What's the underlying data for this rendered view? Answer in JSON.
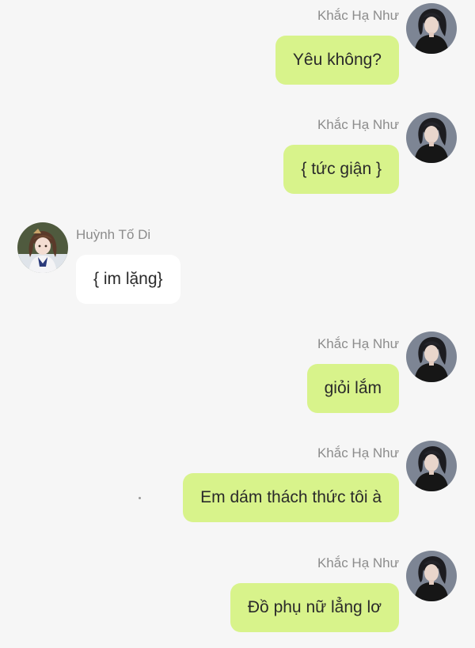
{
  "messages": [
    {
      "side": "right",
      "sender": "Khắc Hạ Như",
      "text": "Yêu không?",
      "avatar": "dark-hair-woman-avatar"
    },
    {
      "side": "right",
      "sender": "Khắc Hạ Như",
      "text": "{ tức giận }",
      "avatar": "dark-hair-woman-avatar"
    },
    {
      "side": "left",
      "sender": "Huỳnh Tố Di",
      "text": "{ im lặng}",
      "avatar": "schoolgirl-avatar"
    },
    {
      "side": "right",
      "sender": "Khắc Hạ Như",
      "text": "giỏi lắm",
      "avatar": "dark-hair-woman-avatar"
    },
    {
      "side": "right",
      "sender": "Khắc Hạ Như",
      "text": "Em dám thách thức tôi à",
      "avatar": "dark-hair-woman-avatar"
    },
    {
      "side": "right",
      "sender": "Khắc Hạ Như",
      "text": "Đồ phụ nữ lẳng lơ",
      "avatar": "dark-hair-woman-avatar"
    }
  ],
  "colors": {
    "background": "#f6f6f6",
    "outgoing_bubble": "#d8f38b",
    "incoming_bubble": "#ffffff",
    "sender_name": "#8c8c8c",
    "message_text": "#2a2a2a"
  }
}
